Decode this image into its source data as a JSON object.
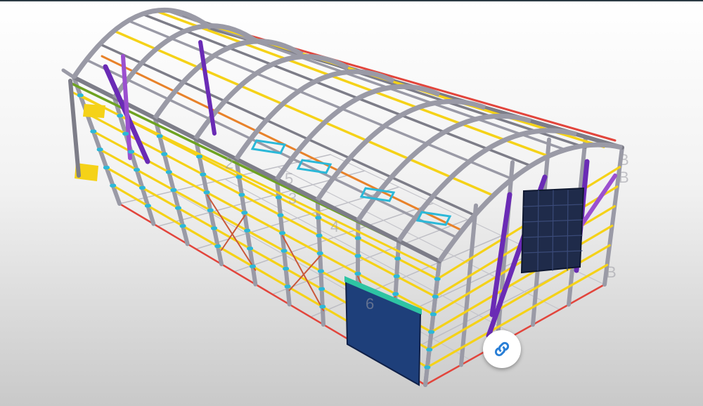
{
  "viewer": {
    "background_top": "#ffffff",
    "background_bottom": "#c9c9c9"
  },
  "model": {
    "description_label": "",
    "grid_labels": [
      "2",
      "3",
      "4",
      "5",
      "6",
      "B",
      "B",
      "B"
    ],
    "colors": {
      "steel": "#9a9aa6",
      "steel_dark": "#7d7d88",
      "girt_yellow": "#f5d218",
      "purlin_orange": "#e8822a",
      "eave_red": "#e2453c",
      "brace_purple": "#6a2bb5",
      "brace_violet": "#9b4fcf",
      "rail_green": "#6ea321",
      "clip_cyan": "#2bb8d8",
      "door_blue": "#1e3f7a",
      "door_frame_teal": "#2ec4a3",
      "window_blue": "#3f6fb0",
      "sheet_dark": "#1f2b4a"
    }
  },
  "controls": {
    "link_button": {
      "icon": "link-icon",
      "color": "#2a7fd6"
    }
  }
}
